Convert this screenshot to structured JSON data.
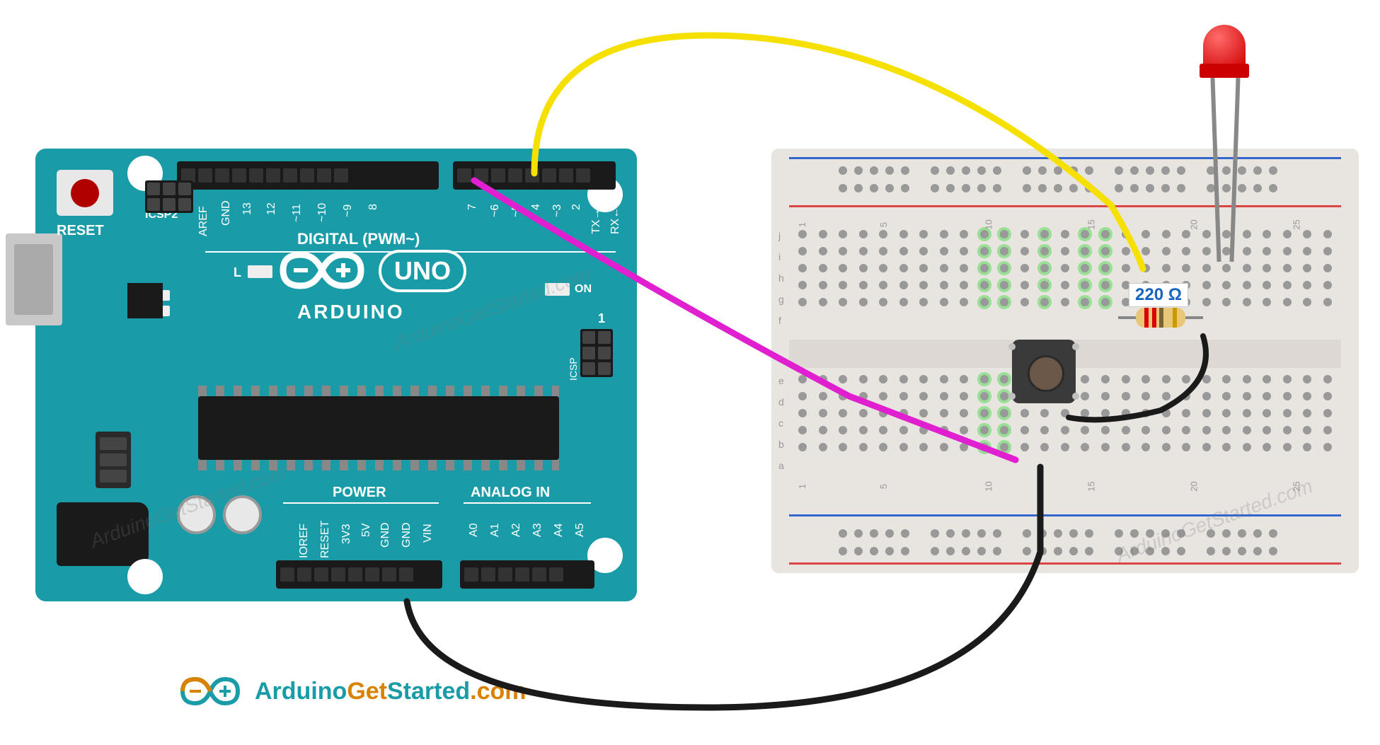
{
  "arduino": {
    "reset_label": "RESET",
    "brand": "ARDUINO",
    "model": "UNO",
    "digital_label": "DIGITAL (PWM~)",
    "power_label": "POWER",
    "analog_label": "ANALOG IN",
    "icsp2_label": "ICSP2",
    "icsp_label": "ICSP",
    "on_label": "ON",
    "l_label": "L",
    "tx_label": "TX",
    "rx_label": "RX",
    "one_label": "1",
    "digital_pins": [
      "AREF",
      "GND",
      "13",
      "12",
      "~11",
      "~10",
      "~9",
      "8",
      "7",
      "~6",
      "~5",
      "4",
      "~3",
      "2",
      "TX→1",
      "RX←0"
    ],
    "power_pins": [
      "IOREF",
      "RESET",
      "3V3",
      "5V",
      "GND",
      "GND",
      "VIN"
    ],
    "analog_pins": [
      "A0",
      "A1",
      "A2",
      "A3",
      "A4",
      "A5"
    ]
  },
  "breadboard": {
    "row_labels_top": [
      "j",
      "i",
      "h",
      "g",
      "f"
    ],
    "row_labels_bottom": [
      "e",
      "d",
      "c",
      "b",
      "a"
    ],
    "col_numbers": [
      "1",
      "5",
      "10",
      "15",
      "20",
      "25"
    ]
  },
  "components": {
    "resistor_value": "220 Ω",
    "led_color": "#d00000",
    "button_type": "tactile"
  },
  "wires": [
    {
      "name": "yellow",
      "from": "arduino-D3",
      "to": "breadboard-j13",
      "color": "#f5e000"
    },
    {
      "name": "magenta",
      "from": "arduino-D7",
      "to": "breadboard-a10",
      "color": "#e020d0"
    },
    {
      "name": "black-gnd",
      "from": "arduino-GND",
      "to": "breadboard-a11",
      "color": "#1a1a1a"
    },
    {
      "name": "black-led",
      "from": "breadboard-f16",
      "to": "breadboard-d11",
      "color": "#1a1a1a"
    }
  ],
  "watermark_text": "ArduinoGetStarted.com",
  "footer": {
    "text_arduino": "Arduino",
    "text_get": "Get",
    "text_started": "Started",
    "text_com": ".com"
  }
}
